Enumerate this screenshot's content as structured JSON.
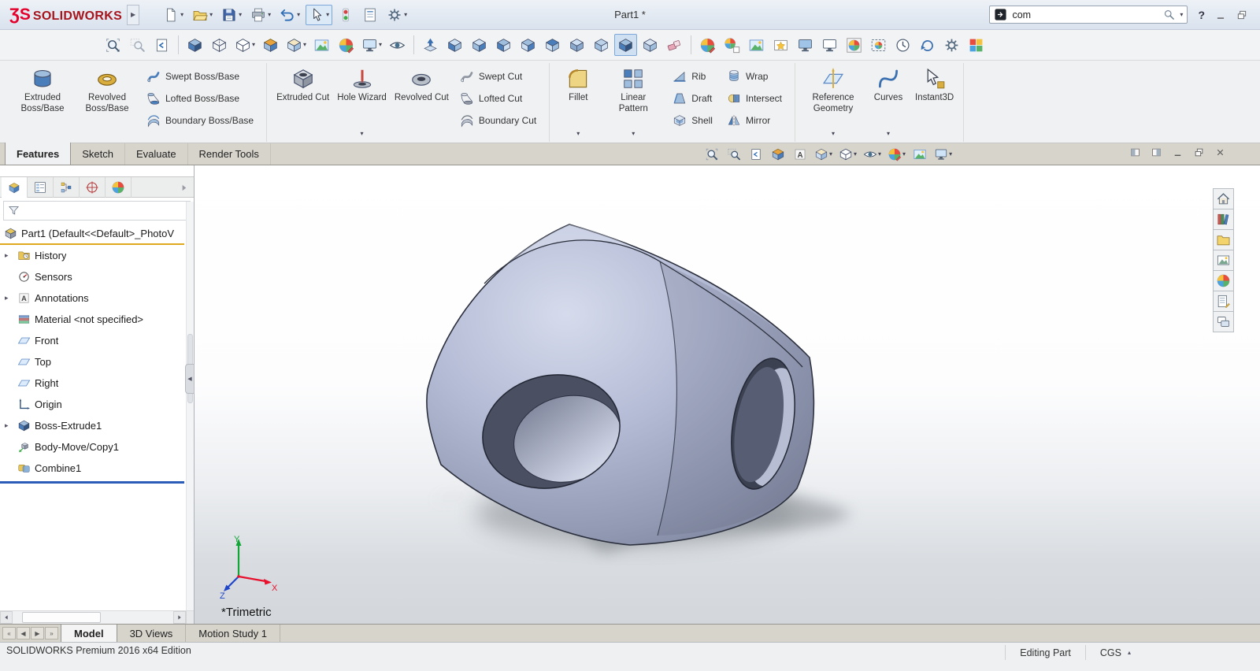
{
  "titlebar": {
    "logo_mark": "ƷS",
    "logo_text": "SOLIDWORKS",
    "flyout_arrow": "▶",
    "document_title": "Part1 *",
    "search_value": "com",
    "help_label": "?",
    "quick_access": [
      {
        "name": "new-document",
        "dropdown": true
      },
      {
        "name": "open",
        "dropdown": true
      },
      {
        "name": "save",
        "dropdown": true
      },
      {
        "name": "print",
        "dropdown": true
      },
      {
        "name": "undo",
        "dropdown": true
      },
      {
        "name": "select",
        "dropdown": true,
        "active": true
      },
      {
        "name": "xpress-products"
      },
      {
        "name": "file-properties"
      },
      {
        "name": "options",
        "dropdown": true
      }
    ]
  },
  "view_toolbar": [
    {
      "name": "zoom-to-fit"
    },
    {
      "name": "zoom-area",
      "disabled": true
    },
    {
      "name": "previous-view"
    },
    {
      "sep": true
    },
    {
      "name": "shaded-with-edges"
    },
    {
      "name": "hidden-lines-visible"
    },
    {
      "name": "display-style",
      "dropdown": true
    },
    {
      "name": "section-view"
    },
    {
      "name": "view-orientation",
      "dropdown": true
    },
    {
      "name": "apply-scene"
    },
    {
      "name": "edit-appearance"
    },
    {
      "name": "view-settings",
      "dropdown": true
    },
    {
      "name": "hide-show-items"
    },
    {
      "sep": true
    },
    {
      "name": "normal-to"
    },
    {
      "name": "front-view"
    },
    {
      "name": "back-view"
    },
    {
      "name": "left-view"
    },
    {
      "name": "right-view"
    },
    {
      "name": "top-view"
    },
    {
      "name": "bottom-view"
    },
    {
      "name": "isometric-view"
    },
    {
      "name": "trimetric-view",
      "active": true
    },
    {
      "name": "dimetric-view"
    },
    {
      "name": "clear-selections"
    },
    {
      "sep": true
    },
    {
      "name": "edit-appearance-pv"
    },
    {
      "name": "copy-appearance"
    },
    {
      "name": "edit-scene"
    },
    {
      "name": "edit-decal"
    },
    {
      "name": "integrated-preview"
    },
    {
      "name": "preview-window"
    },
    {
      "name": "final-render"
    },
    {
      "name": "render-region"
    },
    {
      "name": "schedule-render"
    },
    {
      "name": "recall-last-render"
    },
    {
      "name": "render-options"
    },
    {
      "name": "proof-sheet"
    }
  ],
  "ribbon": {
    "groups": [
      {
        "items": [
          {
            "type": "big",
            "icon": "extruded-boss-base",
            "label": "Extruded Boss/Base"
          },
          {
            "type": "big",
            "icon": "revolved-boss-base",
            "label": "Revolved Boss/Base"
          },
          {
            "type": "col",
            "buttons": [
              {
                "icon": "swept-boss-base",
                "label": "Swept Boss/Base"
              },
              {
                "icon": "lofted-boss-base",
                "label": "Lofted Boss/Base"
              },
              {
                "icon": "boundary-boss-base",
                "label": "Boundary Boss/Base"
              }
            ]
          }
        ]
      },
      {
        "items": [
          {
            "type": "big",
            "icon": "extruded-cut",
            "label": "Extruded Cut"
          },
          {
            "type": "big",
            "icon": "hole-wizard",
            "label": "Hole Wizard",
            "caret": true
          },
          {
            "type": "big",
            "icon": "revolved-cut",
            "label": "Revolved Cut"
          },
          {
            "type": "col",
            "buttons": [
              {
                "icon": "swept-cut",
                "label": "Swept Cut"
              },
              {
                "icon": "lofted-cut",
                "label": "Lofted Cut"
              },
              {
                "icon": "boundary-cut",
                "label": "Boundary Cut"
              }
            ]
          }
        ]
      },
      {
        "items": [
          {
            "type": "big",
            "icon": "fillet",
            "label": "Fillet",
            "caret": true
          },
          {
            "type": "big",
            "icon": "linear-pattern",
            "label": "Linear Pattern",
            "caret": true
          },
          {
            "type": "col",
            "buttons": [
              {
                "icon": "rib",
                "label": "Rib"
              },
              {
                "icon": "draft",
                "label": "Draft"
              },
              {
                "icon": "shell",
                "label": "Shell"
              }
            ]
          },
          {
            "type": "col",
            "buttons": [
              {
                "icon": "wrap",
                "label": "Wrap"
              },
              {
                "icon": "intersect",
                "label": "Intersect"
              },
              {
                "icon": "mirror",
                "label": "Mirror"
              }
            ]
          }
        ]
      },
      {
        "items": [
          {
            "type": "big",
            "icon": "reference-geometry",
            "label": "Reference Geometry",
            "caret": true
          },
          {
            "type": "big",
            "icon": "curves",
            "label": "Curves",
            "caret": true
          },
          {
            "type": "big",
            "icon": "instant3d",
            "label": "Instant3D"
          }
        ]
      }
    ]
  },
  "command_tabs": [
    {
      "label": "Features",
      "active": true
    },
    {
      "label": "Sketch"
    },
    {
      "label": "Evaluate"
    },
    {
      "label": "Render Tools"
    }
  ],
  "headsup": [
    {
      "name": "zoom-to-fit"
    },
    {
      "name": "zoom-area"
    },
    {
      "name": "previous-view"
    },
    {
      "name": "section-view"
    },
    {
      "name": "dynamic-annotation-views"
    },
    {
      "name": "view-orientation",
      "dropdown": true
    },
    {
      "name": "display-style",
      "dropdown": true
    },
    {
      "name": "hide-show-items",
      "dropdown": true
    },
    {
      "name": "edit-appearance",
      "dropdown": true
    },
    {
      "name": "apply-scene"
    },
    {
      "name": "view-settings",
      "dropdown": true
    }
  ],
  "doc_window_buttons": [
    {
      "name": "maximize-pane"
    },
    {
      "name": "split-pane"
    },
    {
      "name": "minimize-document"
    },
    {
      "name": "restore-document"
    },
    {
      "name": "close-document"
    }
  ],
  "panel_tabs": [
    {
      "name": "featuremanager",
      "active": true
    },
    {
      "name": "propertymanager"
    },
    {
      "name": "configurationmanager"
    },
    {
      "name": "dimxpertmanager"
    },
    {
      "name": "displaymanager"
    }
  ],
  "feature_tree": {
    "root": {
      "label": "Part1 (Default<<Default>_PhotoV",
      "icon": "part"
    },
    "items": [
      {
        "label": "History",
        "icon": "history",
        "expand": true
      },
      {
        "label": "Sensors",
        "icon": "sensors"
      },
      {
        "label": "Annotations",
        "icon": "annotations",
        "expand": true
      },
      {
        "label": "Material <not specified>",
        "icon": "material"
      },
      {
        "label": "Front",
        "icon": "plane"
      },
      {
        "label": "Top",
        "icon": "plane"
      },
      {
        "label": "Right",
        "icon": "plane"
      },
      {
        "label": "Origin",
        "icon": "origin"
      },
      {
        "label": "Boss-Extrude1",
        "icon": "boss-extrude",
        "expand": true
      },
      {
        "label": "Body-Move/Copy1",
        "icon": "body-move"
      },
      {
        "label": "Combine1",
        "icon": "combine"
      }
    ]
  },
  "graphics": {
    "view_label": "*Trimetric",
    "triad": {
      "x": "X",
      "y": "Y",
      "z": "Z"
    }
  },
  "task_pane": [
    {
      "name": "solidworks-resources"
    },
    {
      "name": "design-library"
    },
    {
      "name": "file-explorer"
    },
    {
      "name": "view-palette"
    },
    {
      "name": "appearances-scenes"
    },
    {
      "name": "custom-properties"
    },
    {
      "name": "solidworks-forum"
    }
  ],
  "bottom_bar": {
    "nav": [
      "«",
      "◀",
      "▶",
      "»"
    ],
    "tabs": [
      {
        "label": "Model",
        "active": true
      },
      {
        "label": "3D Views"
      },
      {
        "label": "Motion Study 1"
      }
    ]
  },
  "statusbar": {
    "edition": "SOLIDWORKS Premium 2016 x64 Edition",
    "mode": "Editing Part",
    "units": "CGS",
    "units_caret": "▴"
  }
}
